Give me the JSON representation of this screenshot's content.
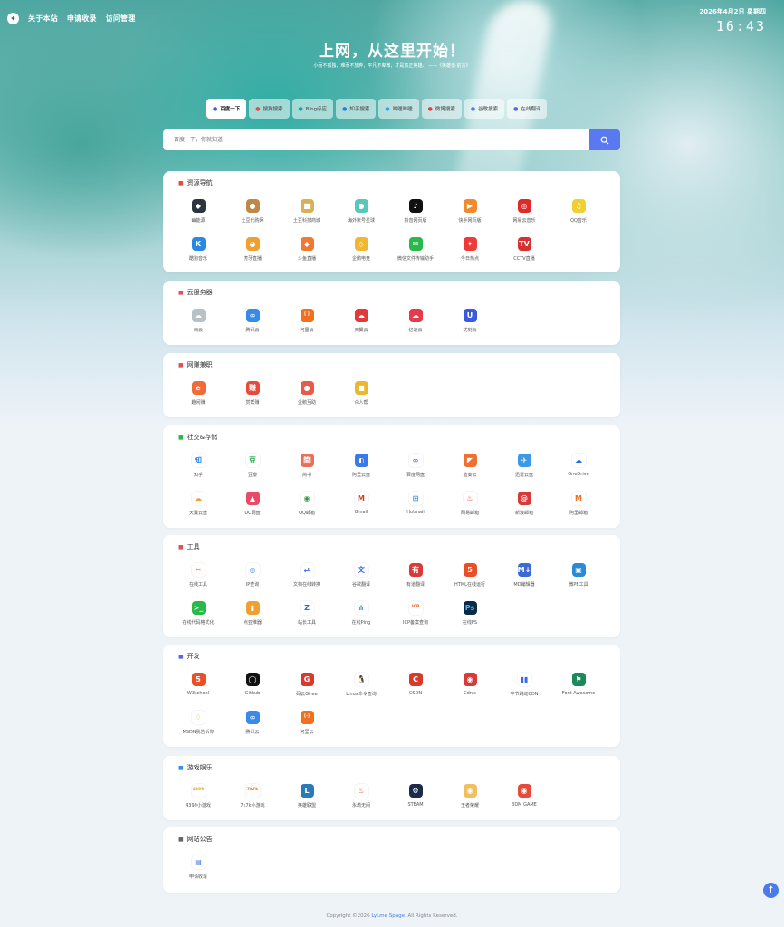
{
  "nav": {
    "logo_icon": "compass-icon",
    "links": [
      "关于本站",
      "申请收录",
      "访问管理"
    ]
  },
  "datetime": {
    "date": "2026年4月2日 星期四",
    "time": "16:43"
  },
  "hero": {
    "title": "上网，从这里开始！",
    "subtitle": "小而不孤独，难而不放弃，平凡不卑微，才是真正英雄。 ——《英雄谱·前言》"
  },
  "engines": [
    {
      "label": "百度一下",
      "icon": "baidu-icon",
      "color": "#3060e0",
      "active": true
    },
    {
      "label": "搜狗搜索",
      "icon": "sogou-icon",
      "color": "#e04a3a",
      "active": false
    },
    {
      "label": "Bing必应",
      "icon": "bing-icon",
      "color": "#1aa0a8",
      "active": false
    },
    {
      "label": "知乎搜索",
      "icon": "zhihu-icon",
      "color": "#1e80f0",
      "active": false
    },
    {
      "label": "哔哩哔哩",
      "icon": "bilibili-icon",
      "color": "#3aa0e8",
      "active": false
    },
    {
      "label": "微博搜索",
      "icon": "weibo-icon",
      "color": "#e8402e",
      "active": false
    },
    {
      "label": "谷歌搜索",
      "icon": "google-icon",
      "color": "#4285f4",
      "active": false
    },
    {
      "label": "在线翻译",
      "icon": "translate-icon",
      "color": "#5a64e8",
      "active": false
    }
  ],
  "search": {
    "placeholder": "百度一下，你就知道",
    "button_icon": "search-icon"
  },
  "sections": [
    {
      "title": "资源导航",
      "icon": "fire-icon",
      "icon_color": "#e84a3a",
      "items": [
        {
          "label": "幽能源",
          "icon": "youneng-icon",
          "bg": "#2c3440",
          "glyph": "◆"
        },
        {
          "label": "土豆代购网",
          "icon": "potato-icon",
          "bg": "#c08848",
          "glyph": "●"
        },
        {
          "label": "土豆科技商城",
          "icon": "shop-icon",
          "bg": "#d8b058",
          "glyph": "■"
        },
        {
          "label": "海外账号星球",
          "icon": "planet-icon",
          "bg": "#5ac8b8",
          "glyph": "●"
        },
        {
          "label": "抖音网页版",
          "icon": "douyin-icon",
          "bg": "#111111",
          "glyph": "♪"
        },
        {
          "label": "快手网页版",
          "icon": "kuaishou-icon",
          "bg": "#f08a30",
          "glyph": "▶"
        },
        {
          "label": "网易云音乐",
          "icon": "netease-music-icon",
          "bg": "#e02a2a",
          "glyph": "◎"
        },
        {
          "label": "QQ音乐",
          "icon": "qqmusic-icon",
          "bg": "#f0d030",
          "glyph": "♫"
        },
        {
          "label": "酷狗音乐",
          "icon": "kugou-icon",
          "bg": "#2a88e0",
          "glyph": "K"
        },
        {
          "label": "虎牙直播",
          "icon": "huya-icon",
          "bg": "#f0a030",
          "glyph": "◕"
        },
        {
          "label": "斗鱼直播",
          "icon": "douyu-icon",
          "bg": "#f07830",
          "glyph": "◆"
        },
        {
          "label": "企鹅电竞",
          "icon": "egame-icon",
          "bg": "#f0b830",
          "glyph": "◇"
        },
        {
          "label": "微信文件传输助手",
          "icon": "wechat-icon",
          "bg": "#2ab84a",
          "glyph": "✉"
        },
        {
          "label": "今日热点",
          "icon": "hot-icon",
          "bg": "#ef3a3a",
          "glyph": "✦"
        },
        {
          "label": "CCTV直播",
          "icon": "cctv-icon",
          "bg": "#d83030",
          "glyph": "TV"
        }
      ]
    },
    {
      "title": "云服务器",
      "icon": "server-icon",
      "icon_color": "#e0505a",
      "items": [
        {
          "label": "雨云",
          "icon": "rainyun-icon",
          "bg": "#b8c0c8",
          "glyph": "☁"
        },
        {
          "label": "腾讯云",
          "icon": "tencent-cloud-icon",
          "bg": "#3a8ae8",
          "glyph": "∞"
        },
        {
          "label": "阿里云",
          "icon": "aliyun-icon",
          "bg": "#f07020",
          "glyph": "[ ]"
        },
        {
          "label": "天翼云",
          "icon": "tianyi-icon",
          "bg": "#e03a3a",
          "glyph": "☁"
        },
        {
          "label": "亿速云",
          "icon": "yisu-icon",
          "bg": "#e83a4a",
          "glyph": "☁"
        },
        {
          "label": "优刻云",
          "icon": "ucloud-icon",
          "bg": "#3a5ae0",
          "glyph": "U"
        }
      ]
    },
    {
      "title": "网赚兼职",
      "icon": "money-icon",
      "icon_color": "#e0505a",
      "items": [
        {
          "label": "趣闲赚",
          "icon": "quxianzhuan-icon",
          "bg": "#f06a3a",
          "glyph": "e"
        },
        {
          "label": "赏帮赚",
          "icon": "shangbang-icon",
          "bg": "#e84a3a",
          "glyph": "赚"
        },
        {
          "label": "企鹅互助",
          "icon": "penguin-icon",
          "bg": "#e85a4a",
          "glyph": "●"
        },
        {
          "label": "众人帮",
          "icon": "zhongren-icon",
          "bg": "#e8b830",
          "glyph": "■"
        }
      ]
    },
    {
      "title": "社交&存储",
      "icon": "social-icon",
      "icon_color": "#2ab84a",
      "items": [
        {
          "label": "知乎",
          "icon": "zhihu-icon",
          "bg": "#ffffff",
          "fg": "#1e80f0",
          "glyph": "知"
        },
        {
          "label": "豆瓣",
          "icon": "douban-icon",
          "bg": "#ffffff",
          "fg": "#2aa84a",
          "glyph": "豆"
        },
        {
          "label": "简书",
          "icon": "jianshu-icon",
          "bg": "#ea6f5a",
          "glyph": "简"
        },
        {
          "label": "阿里云盘",
          "icon": "aliyun-drive-icon",
          "bg": "#3a7ae8",
          "glyph": "◐"
        },
        {
          "label": "百度网盘",
          "icon": "baidu-drive-icon",
          "bg": "#ffffff",
          "fg": "#3a7ae8",
          "glyph": "∞"
        },
        {
          "label": "蓝奏云",
          "icon": "lanzou-icon",
          "bg": "#f07030",
          "glyph": "◤"
        },
        {
          "label": "迅雷云盘",
          "icon": "xunlei-icon",
          "bg": "#3a9ae8",
          "glyph": "✈"
        },
        {
          "label": "OneDrive",
          "icon": "onedrive-icon",
          "bg": "#ffffff",
          "fg": "#1a70d8",
          "glyph": "☁"
        },
        {
          "label": "天翼云盘",
          "icon": "tianyi-drive-icon",
          "bg": "#ffffff",
          "fg": "#f0a030",
          "glyph": "☁"
        },
        {
          "label": "UC网盘",
          "icon": "uc-drive-icon",
          "bg": "#e84a6a",
          "glyph": "▲"
        },
        {
          "label": "QQ邮箱",
          "icon": "qqmail-icon",
          "bg": "#ffffff",
          "fg": "#3a9a48",
          "glyph": "◉"
        },
        {
          "label": "Gmail",
          "icon": "gmail-icon",
          "bg": "#ffffff",
          "fg": "#d83a2a",
          "glyph": "M"
        },
        {
          "label": "Hotmail",
          "icon": "hotmail-icon",
          "bg": "#ffffff",
          "fg": "#3a8ae8",
          "glyph": "⊞"
        },
        {
          "label": "网易邮箱",
          "icon": "163mail-icon",
          "bg": "#ffffff",
          "fg": "#d83a3a",
          "glyph": "♨"
        },
        {
          "label": "新浪邮箱",
          "icon": "sinamail-icon",
          "bg": "#d83a3a",
          "glyph": "@"
        },
        {
          "label": "阿里邮箱",
          "icon": "alimail-icon",
          "bg": "#ffffff",
          "fg": "#f07020",
          "glyph": "M"
        }
      ]
    },
    {
      "title": "工具",
      "icon": "tools-icon",
      "icon_color": "#e0505a",
      "items": [
        {
          "label": "在线工具",
          "icon": "wrench-icon",
          "bg": "#ffffff",
          "fg": "#d84a3a",
          "glyph": "✂"
        },
        {
          "label": "IP查询",
          "icon": "ip-icon",
          "bg": "#ffffff",
          "fg": "#3a8ae8",
          "glyph": "◎"
        },
        {
          "label": "文档在线转换",
          "icon": "doc-convert-icon",
          "bg": "#ffffff",
          "fg": "#3a6ae8",
          "glyph": "⇄"
        },
        {
          "label": "谷歌翻译",
          "icon": "google-translate-icon",
          "bg": "#ffffff",
          "fg": "#3a6ae8",
          "glyph": "文"
        },
        {
          "label": "有道翻译",
          "icon": "youdao-icon",
          "bg": "#d83a3a",
          "glyph": "有"
        },
        {
          "label": "HTML在线运行",
          "icon": "html5-icon",
          "bg": "#e8502a",
          "glyph": "5"
        },
        {
          "label": "MD编辑器",
          "icon": "markdown-icon",
          "bg": "#3a6ad8",
          "glyph": "M↓"
        },
        {
          "label": "微PE工具",
          "icon": "wepe-icon",
          "bg": "#2a8ad8",
          "glyph": "▣"
        },
        {
          "label": "在线代码格式化",
          "icon": "code-format-icon",
          "bg": "#2ab84a",
          "glyph": ">_"
        },
        {
          "label": "点亚维器",
          "icon": "lock-icon",
          "bg": "#f0a030",
          "glyph": "▮"
        },
        {
          "label": "站长工具",
          "icon": "webmaster-icon",
          "bg": "#ffffff",
          "fg": "#2a6ad8",
          "glyph": "Z"
        },
        {
          "label": "在线Ping",
          "icon": "ping-icon",
          "bg": "#ffffff",
          "fg": "#3a8ae8",
          "glyph": "⋔"
        },
        {
          "label": "ICP备案查询",
          "icon": "icp-icon",
          "bg": "#ffffff",
          "fg": "#e85a2a",
          "glyph": "ICP"
        },
        {
          "label": "在线PS",
          "icon": "photoshop-icon",
          "bg": "#0a2a48",
          "fg": "#4ab0f0",
          "glyph": "Ps"
        }
      ]
    },
    {
      "title": "开发",
      "icon": "dev-icon",
      "icon_color": "#5a64e8",
      "items": [
        {
          "label": "W3school",
          "icon": "w3school-icon",
          "bg": "#e8502a",
          "glyph": "5"
        },
        {
          "label": "Github",
          "icon": "github-icon",
          "bg": "#111111",
          "glyph": "◯"
        },
        {
          "label": "码云Gitee",
          "icon": "gitee-icon",
          "bg": "#d83a2a",
          "glyph": "G"
        },
        {
          "label": "Linux命令查询",
          "icon": "linux-icon",
          "bg": "#ffffff",
          "fg": "#222222",
          "glyph": "🐧"
        },
        {
          "label": "CSDN",
          "icon": "csdn-icon",
          "bg": "#d83a2a",
          "glyph": "C"
        },
        {
          "label": "Cdnjs",
          "icon": "cdnjs-icon",
          "bg": "#d83a3a",
          "glyph": "◉"
        },
        {
          "label": "字节跳动CDN",
          "icon": "bytedance-icon",
          "bg": "#ffffff",
          "fg": "#3a6ae8",
          "glyph": "▮▮"
        },
        {
          "label": "Font Awesome",
          "icon": "flag-icon",
          "bg": "#1a8a5a",
          "glyph": "⚑"
        },
        {
          "label": "MSDN我告诉你",
          "icon": "msdn-icon",
          "bg": "#ffffff",
          "fg": "#e8a030",
          "glyph": "♢"
        },
        {
          "label": "腾讯云",
          "icon": "tencent-cloud-icon",
          "bg": "#3a8ae8",
          "glyph": "∞"
        },
        {
          "label": "阿里云",
          "icon": "aliyun-icon",
          "bg": "#f07020",
          "glyph": "[-]"
        }
      ]
    },
    {
      "title": "游戏娱乐",
      "icon": "game-icon",
      "icon_color": "#3a8ae8",
      "items": [
        {
          "label": "4399小游戏",
          "icon": "4399-icon",
          "bg": "#ffffff",
          "fg": "#e8a030",
          "glyph": "4399"
        },
        {
          "label": "7k7k小游戏",
          "icon": "7k7k-icon",
          "bg": "#ffffff",
          "fg": "#f07020",
          "glyph": "7k7k"
        },
        {
          "label": "英雄联盟",
          "icon": "lol-icon",
          "bg": "#2a7ab8",
          "glyph": "L"
        },
        {
          "label": "永劫无间",
          "icon": "naraka-icon",
          "bg": "#ffffff",
          "fg": "#d83a3a",
          "glyph": "♨"
        },
        {
          "label": "STEAM",
          "icon": "steam-icon",
          "bg": "#1a2a48",
          "glyph": "⚙"
        },
        {
          "label": "王者荣耀",
          "icon": "honor-icon",
          "bg": "#f0c060",
          "glyph": "◉"
        },
        {
          "label": "3DM GAME",
          "icon": "3dm-icon",
          "bg": "#e84a3a",
          "glyph": "◉"
        }
      ]
    },
    {
      "title": "网站公告",
      "icon": "announcement-icon",
      "icon_color": "#666666",
      "items": [
        {
          "label": "申请收录",
          "icon": "apply-icon",
          "bg": "#ffffff",
          "fg": "#3a6ae8",
          "glyph": "▤"
        }
      ]
    }
  ],
  "footer": {
    "prefix": "Copyright ©2026 ",
    "link": "LyLme Spage",
    "suffix": ". All Rights Reserved."
  },
  "to_top_icon": "arrow-up-icon"
}
